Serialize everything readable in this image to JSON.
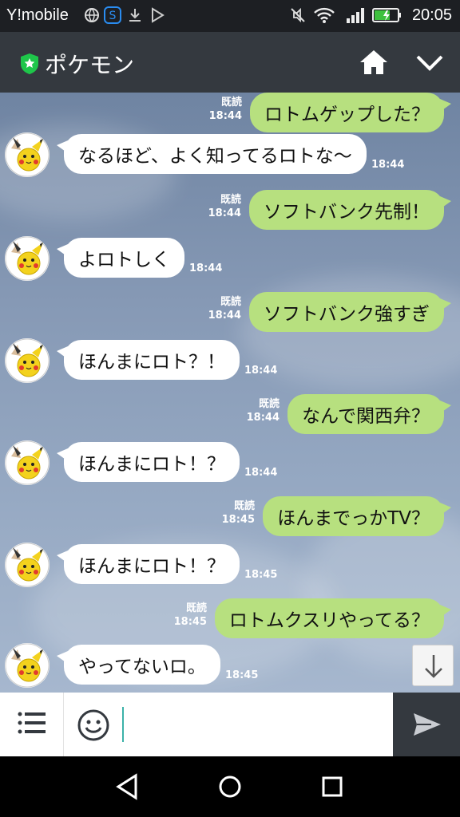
{
  "status_bar": {
    "carrier": "Y!mobile",
    "time": "20:05"
  },
  "header": {
    "title": "ポケモン",
    "icons": [
      "shield-star-icon",
      "home-icon",
      "chevron-down-icon"
    ]
  },
  "messages": [
    {
      "direction": "out",
      "text": "ロトムゲップした？",
      "read": "既読",
      "time": "18:44"
    },
    {
      "direction": "in",
      "text": "なるほど、よく知ってるロトな〜",
      "time": "18:44"
    },
    {
      "direction": "out",
      "text": "ソフトバンク先制！",
      "read": "既読",
      "time": "18:44"
    },
    {
      "direction": "in",
      "text": "よロトしく",
      "time": "18:44"
    },
    {
      "direction": "out",
      "text": "ソフトバンク強すぎ",
      "read": "既読",
      "time": "18:44"
    },
    {
      "direction": "in",
      "text": "ほんまにロト？！",
      "time": "18:44"
    },
    {
      "direction": "out",
      "text": "なんで関西弁？",
      "read": "既読",
      "time": "18:44"
    },
    {
      "direction": "in",
      "text": "ほんまにロト！？",
      "time": "18:44"
    },
    {
      "direction": "out",
      "text": "ほんまでっかTV？",
      "read": "既読",
      "time": "18:45"
    },
    {
      "direction": "in",
      "text": "ほんまにロト！？",
      "time": "18:45"
    },
    {
      "direction": "out",
      "text": "ロトムクスリやってる？",
      "read": "既読",
      "time": "18:45"
    },
    {
      "direction": "in",
      "text": "やってないロ。",
      "time": "18:45"
    }
  ],
  "input_bar": {
    "value": "",
    "icons": [
      "menu-icon",
      "emoji-icon",
      "send-icon"
    ]
  },
  "colors": {
    "header_bg": "#34393f",
    "outgoing_bubble": "#b7e07f",
    "incoming_bubble": "#ffffff",
    "cursor": "#3cb2a9"
  },
  "nav_icons": [
    "back-icon",
    "home-circle-icon",
    "recents-icon"
  ]
}
